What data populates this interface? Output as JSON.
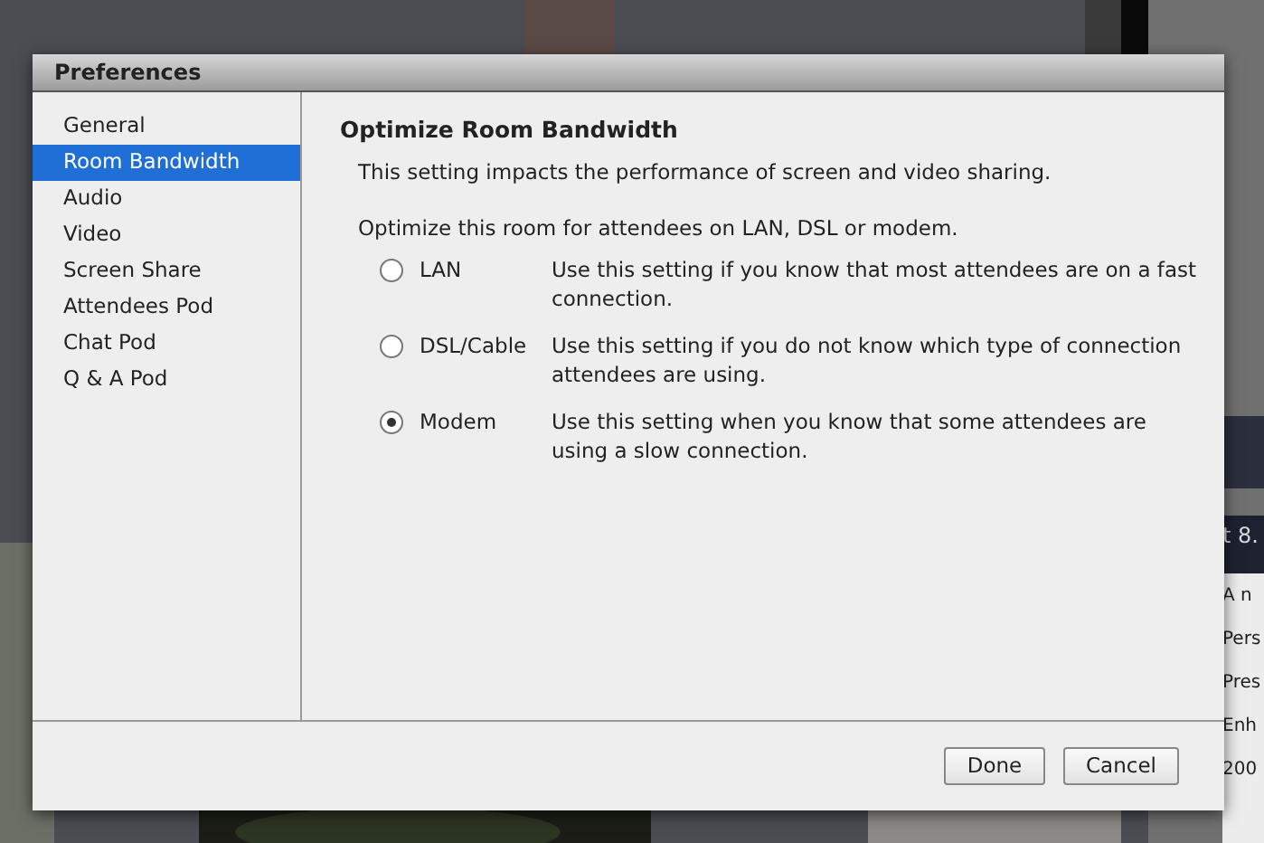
{
  "background": {
    "fragments": [
      {
        "text": "t 8.",
        "kind": "heading"
      },
      {
        "text": "A n",
        "kind": "line"
      },
      {
        "text": "Pers",
        "kind": "line"
      },
      {
        "text": "Pres",
        "kind": "line"
      },
      {
        "text": "Enh",
        "kind": "line"
      },
      {
        "text": "200",
        "kind": "line"
      }
    ]
  },
  "window": {
    "title": "Preferences"
  },
  "sidebar": {
    "items": [
      {
        "label": "General",
        "selected": false
      },
      {
        "label": "Room Bandwidth",
        "selected": true
      },
      {
        "label": "Audio",
        "selected": false
      },
      {
        "label": "Video",
        "selected": false
      },
      {
        "label": "Screen Share",
        "selected": false
      },
      {
        "label": "Attendees Pod",
        "selected": false
      },
      {
        "label": "Chat Pod",
        "selected": false
      },
      {
        "label": "Q & A Pod",
        "selected": false
      }
    ]
  },
  "content": {
    "heading": "Optimize Room Bandwidth",
    "description": "This setting impacts the performance of screen and video sharing.",
    "prompt": "Optimize this room for attendees on LAN, DSL or modem.",
    "options": [
      {
        "label": "LAN",
        "description": "Use this setting if you know that most attendees are on a fast connection.",
        "selected": false
      },
      {
        "label": "DSL/Cable",
        "description": "Use this setting if you do not know which type of connection attendees are using.",
        "selected": false
      },
      {
        "label": "Modem",
        "description": "Use this setting when you know that some attendees are using a slow connection.",
        "selected": true
      }
    ]
  },
  "buttons": [
    "Done",
    "Cancel"
  ]
}
